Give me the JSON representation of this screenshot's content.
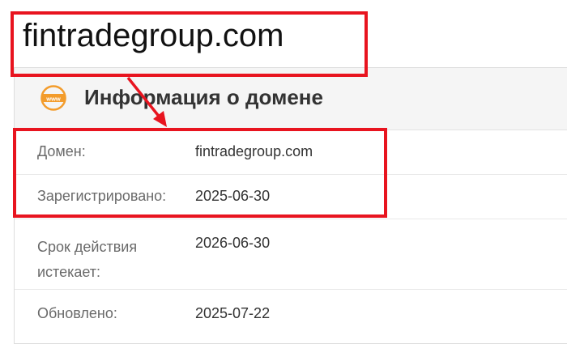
{
  "heading": {
    "domain": "fintradegroup.com"
  },
  "panel": {
    "icon": "www-globe-icon",
    "title": "Информация о домене",
    "rows": [
      {
        "label": "Домен:",
        "value": "fintradegroup.com"
      },
      {
        "label": "Зарегистрировано:",
        "value": "2025-06-30"
      },
      {
        "label": "Срок действия истекает:",
        "value": "2026-06-30"
      },
      {
        "label": "Обновлено:",
        "value": "2025-07-22"
      }
    ]
  },
  "annotation": {
    "color": "#e8141f"
  },
  "colors": {
    "icon_orange": "#f39c2c",
    "header_bg": "#f5f5f5"
  }
}
